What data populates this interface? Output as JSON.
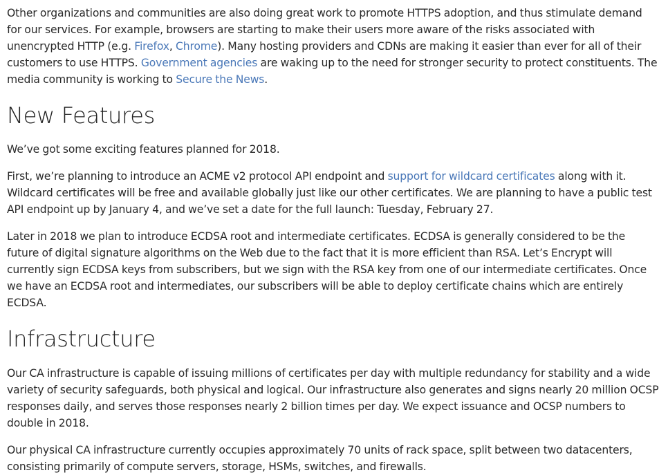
{
  "intro": {
    "t1": "Other organizations and communities are also doing great work to promote HTTPS adoption, and thus stimulate demand for our services. For example, browsers are starting to make their users more aware of the risks associated with unencrypted HTTP (e.g. ",
    "link_firefox": "Firefox",
    "t2": ", ",
    "link_chrome": "Chrome",
    "t3": "). Many hosting providers and CDNs are making it easier than ever for all of their customers to use HTTPS. ",
    "link_gov": "Government agencies",
    "t4": " are waking up to the need for stronger security to protect constituents. The media community is working to ",
    "link_stn": "Secure the News",
    "t5": "."
  },
  "new_features": {
    "heading": "New Features",
    "p1": "We’ve got some exciting features planned for 2018.",
    "p2_t1": "First, we’re planning to introduce an ACME v2 protocol API endpoint and ",
    "p2_link": "support for wildcard certificates",
    "p2_t2": " along with it. Wildcard certificates will be free and available globally just like our other certificates. We are planning to have a public test API endpoint up by January 4, and we’ve set a date for the full launch: Tuesday, February 27.",
    "p3": "Later in 2018 we plan to introduce ECDSA root and intermediate certificates. ECDSA is generally considered to be the future of digital signature algorithms on the Web due to the fact that it is more efficient than RSA. Let’s Encrypt will currently sign ECDSA keys from subscribers, but we sign with the RSA key from one of our intermediate certificates. Once we have an ECDSA root and intermediates, our subscribers will be able to deploy certificate chains which are entirely ECDSA."
  },
  "infrastructure": {
    "heading": "Infrastructure",
    "p1": "Our CA infrastructure is capable of issuing millions of certificates per day with multiple redundancy for stability and a wide variety of security safeguards, both physical and logical. Our infrastructure also generates and signs nearly 20 million OCSP responses daily, and serves those responses nearly 2 billion times per day. We expect issuance and OCSP numbers to double in 2018.",
    "p2": "Our physical CA infrastructure currently occupies approximately 70 units of rack space, split between two datacenters, consisting primarily of compute servers, storage, HSMs, switches, and firewalls."
  },
  "colors": {
    "text": "#2a2a2a",
    "link": "#4a78b8",
    "background": "#ffffff"
  }
}
